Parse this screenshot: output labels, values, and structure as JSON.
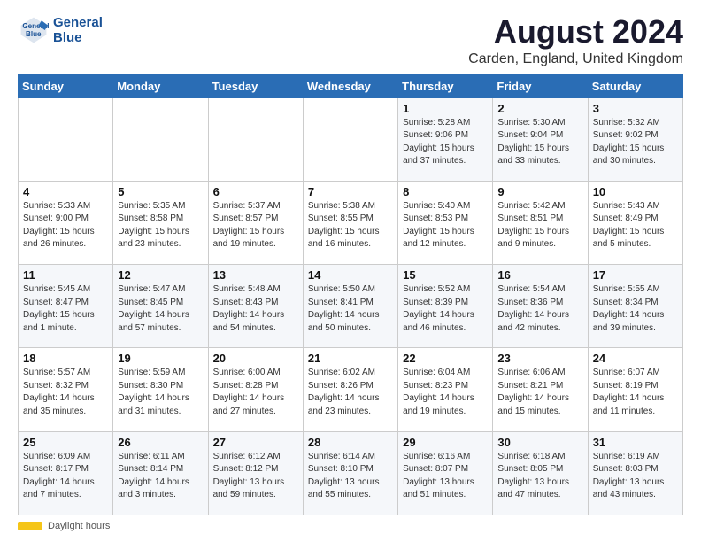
{
  "logo": {
    "line1": "General",
    "line2": "Blue"
  },
  "title": "August 2024",
  "subtitle": "Carden, England, United Kingdom",
  "days_of_week": [
    "Sunday",
    "Monday",
    "Tuesday",
    "Wednesday",
    "Thursday",
    "Friday",
    "Saturday"
  ],
  "footer": {
    "daylight_label": "Daylight hours"
  },
  "weeks": [
    [
      {
        "day": "",
        "info": ""
      },
      {
        "day": "",
        "info": ""
      },
      {
        "day": "",
        "info": ""
      },
      {
        "day": "",
        "info": ""
      },
      {
        "day": "1",
        "info": "Sunrise: 5:28 AM\nSunset: 9:06 PM\nDaylight: 15 hours\nand 37 minutes."
      },
      {
        "day": "2",
        "info": "Sunrise: 5:30 AM\nSunset: 9:04 PM\nDaylight: 15 hours\nand 33 minutes."
      },
      {
        "day": "3",
        "info": "Sunrise: 5:32 AM\nSunset: 9:02 PM\nDaylight: 15 hours\nand 30 minutes."
      }
    ],
    [
      {
        "day": "4",
        "info": "Sunrise: 5:33 AM\nSunset: 9:00 PM\nDaylight: 15 hours\nand 26 minutes."
      },
      {
        "day": "5",
        "info": "Sunrise: 5:35 AM\nSunset: 8:58 PM\nDaylight: 15 hours\nand 23 minutes."
      },
      {
        "day": "6",
        "info": "Sunrise: 5:37 AM\nSunset: 8:57 PM\nDaylight: 15 hours\nand 19 minutes."
      },
      {
        "day": "7",
        "info": "Sunrise: 5:38 AM\nSunset: 8:55 PM\nDaylight: 15 hours\nand 16 minutes."
      },
      {
        "day": "8",
        "info": "Sunrise: 5:40 AM\nSunset: 8:53 PM\nDaylight: 15 hours\nand 12 minutes."
      },
      {
        "day": "9",
        "info": "Sunrise: 5:42 AM\nSunset: 8:51 PM\nDaylight: 15 hours\nand 9 minutes."
      },
      {
        "day": "10",
        "info": "Sunrise: 5:43 AM\nSunset: 8:49 PM\nDaylight: 15 hours\nand 5 minutes."
      }
    ],
    [
      {
        "day": "11",
        "info": "Sunrise: 5:45 AM\nSunset: 8:47 PM\nDaylight: 15 hours\nand 1 minute."
      },
      {
        "day": "12",
        "info": "Sunrise: 5:47 AM\nSunset: 8:45 PM\nDaylight: 14 hours\nand 57 minutes."
      },
      {
        "day": "13",
        "info": "Sunrise: 5:48 AM\nSunset: 8:43 PM\nDaylight: 14 hours\nand 54 minutes."
      },
      {
        "day": "14",
        "info": "Sunrise: 5:50 AM\nSunset: 8:41 PM\nDaylight: 14 hours\nand 50 minutes."
      },
      {
        "day": "15",
        "info": "Sunrise: 5:52 AM\nSunset: 8:39 PM\nDaylight: 14 hours\nand 46 minutes."
      },
      {
        "day": "16",
        "info": "Sunrise: 5:54 AM\nSunset: 8:36 PM\nDaylight: 14 hours\nand 42 minutes."
      },
      {
        "day": "17",
        "info": "Sunrise: 5:55 AM\nSunset: 8:34 PM\nDaylight: 14 hours\nand 39 minutes."
      }
    ],
    [
      {
        "day": "18",
        "info": "Sunrise: 5:57 AM\nSunset: 8:32 PM\nDaylight: 14 hours\nand 35 minutes."
      },
      {
        "day": "19",
        "info": "Sunrise: 5:59 AM\nSunset: 8:30 PM\nDaylight: 14 hours\nand 31 minutes."
      },
      {
        "day": "20",
        "info": "Sunrise: 6:00 AM\nSunset: 8:28 PM\nDaylight: 14 hours\nand 27 minutes."
      },
      {
        "day": "21",
        "info": "Sunrise: 6:02 AM\nSunset: 8:26 PM\nDaylight: 14 hours\nand 23 minutes."
      },
      {
        "day": "22",
        "info": "Sunrise: 6:04 AM\nSunset: 8:23 PM\nDaylight: 14 hours\nand 19 minutes."
      },
      {
        "day": "23",
        "info": "Sunrise: 6:06 AM\nSunset: 8:21 PM\nDaylight: 14 hours\nand 15 minutes."
      },
      {
        "day": "24",
        "info": "Sunrise: 6:07 AM\nSunset: 8:19 PM\nDaylight: 14 hours\nand 11 minutes."
      }
    ],
    [
      {
        "day": "25",
        "info": "Sunrise: 6:09 AM\nSunset: 8:17 PM\nDaylight: 14 hours\nand 7 minutes."
      },
      {
        "day": "26",
        "info": "Sunrise: 6:11 AM\nSunset: 8:14 PM\nDaylight: 14 hours\nand 3 minutes."
      },
      {
        "day": "27",
        "info": "Sunrise: 6:12 AM\nSunset: 8:12 PM\nDaylight: 13 hours\nand 59 minutes."
      },
      {
        "day": "28",
        "info": "Sunrise: 6:14 AM\nSunset: 8:10 PM\nDaylight: 13 hours\nand 55 minutes."
      },
      {
        "day": "29",
        "info": "Sunrise: 6:16 AM\nSunset: 8:07 PM\nDaylight: 13 hours\nand 51 minutes."
      },
      {
        "day": "30",
        "info": "Sunrise: 6:18 AM\nSunset: 8:05 PM\nDaylight: 13 hours\nand 47 minutes."
      },
      {
        "day": "31",
        "info": "Sunrise: 6:19 AM\nSunset: 8:03 PM\nDaylight: 13 hours\nand 43 minutes."
      }
    ]
  ]
}
